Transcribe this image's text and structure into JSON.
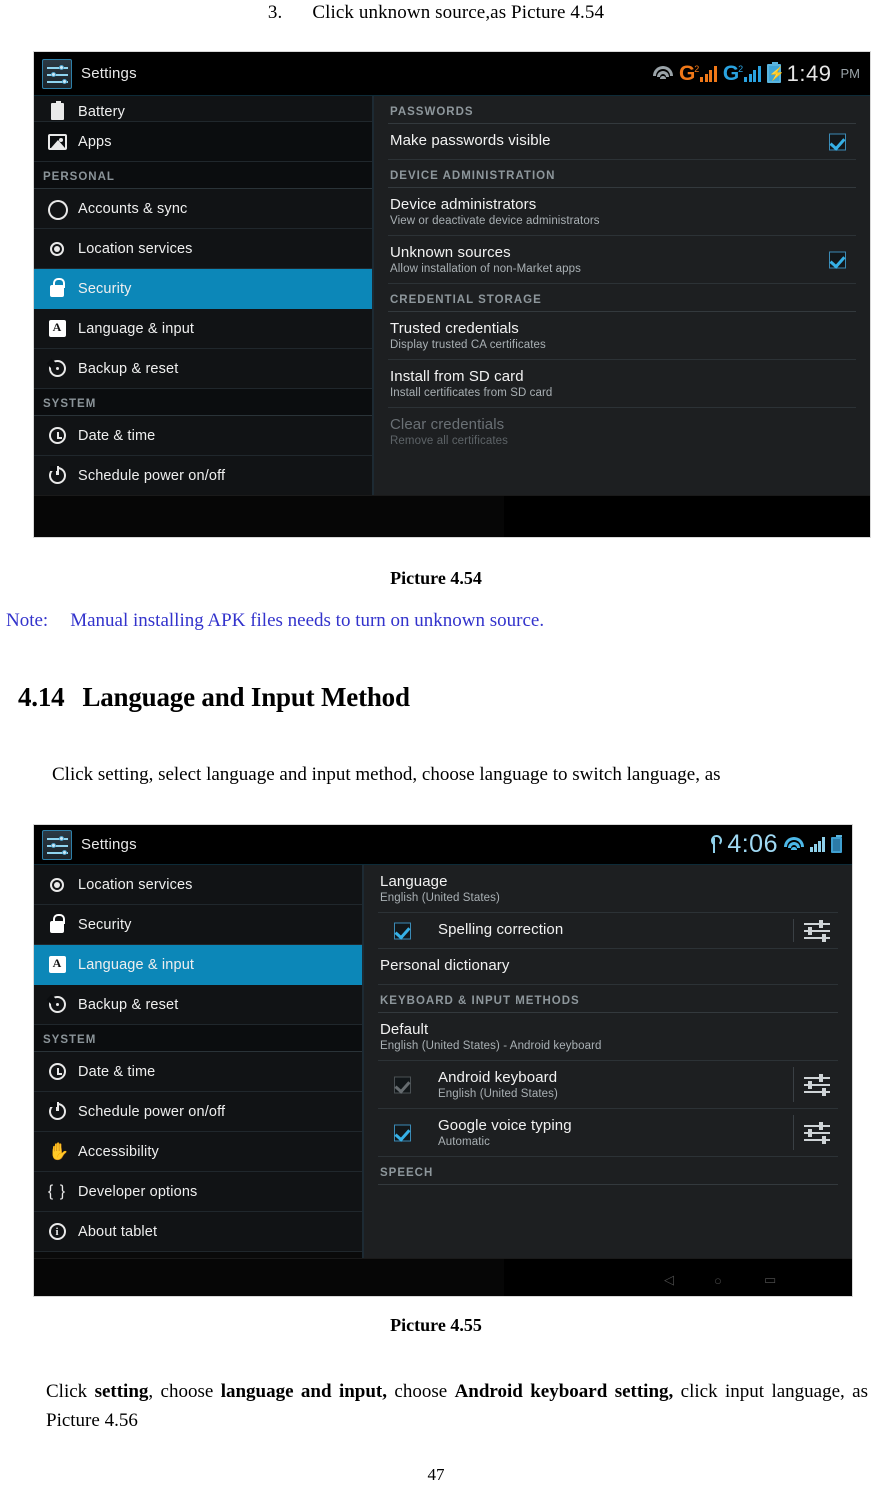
{
  "document": {
    "step_number": "3.",
    "step_text": "Click unknown source,as Picture 4.54",
    "caption_454": "Picture 4.54",
    "note_label": "Note:",
    "note_text": "Manual installing APK files needs to turn on unknown source.",
    "section_number": "4.14",
    "section_title": "Language and Input Method",
    "intro_paragraph": "Click setting, select language and input method, choose language to switch language, as",
    "caption_455": "Picture 4.55",
    "outro": {
      "t1": "Click ",
      "b1": "setting",
      "t2": ", choose ",
      "b2": "language and input,",
      "t3": " choose ",
      "b3": "Android keyboard setting,",
      "t4": " click input language, as Picture 4.56"
    },
    "page_number": "47",
    "note_color": "#3333cc"
  },
  "screenshot_454": {
    "statusbar": {
      "app_title": "Settings",
      "icons": [
        "settings-app-icon",
        "wifi-icon",
        "sim1-g-signal-icon",
        "sim2-g-signal-icon",
        "battery-charging-icon"
      ],
      "sim1": {
        "letter": "G",
        "sup": "2",
        "color": "#f07818"
      },
      "sim2": {
        "letter": "G",
        "sup": "2",
        "color": "#2aa3e0"
      },
      "time": "1:49",
      "ampm": "PM"
    },
    "sidebar": [
      {
        "type": "item",
        "label": "Battery",
        "icon": "battery-icon",
        "selected": false,
        "clipped": true
      },
      {
        "type": "item",
        "label": "Apps",
        "icon": "apps-icon",
        "selected": false
      },
      {
        "type": "header",
        "label": "PERSONAL"
      },
      {
        "type": "item",
        "label": "Accounts & sync",
        "icon": "sync-icon",
        "selected": false
      },
      {
        "type": "item",
        "label": "Location services",
        "icon": "location-icon",
        "selected": false
      },
      {
        "type": "item",
        "label": "Security",
        "icon": "lock-icon",
        "selected": true
      },
      {
        "type": "item",
        "label": "Language & input",
        "icon": "language-a-icon",
        "selected": false
      },
      {
        "type": "item",
        "label": "Backup & reset",
        "icon": "backup-icon",
        "selected": false
      },
      {
        "type": "header",
        "label": "SYSTEM"
      },
      {
        "type": "item",
        "label": "Date & time",
        "icon": "clock-icon",
        "selected": false
      },
      {
        "type": "item",
        "label": "Schedule power on/off",
        "icon": "power-icon",
        "selected": false
      }
    ],
    "content": [
      {
        "type": "header",
        "label": "PASSWORDS"
      },
      {
        "type": "row",
        "title": "Make passwords visible",
        "subtitle": "",
        "checkbox": "checked",
        "checkbox_side": "right"
      },
      {
        "type": "header",
        "label": "DEVICE ADMINISTRATION"
      },
      {
        "type": "row",
        "title": "Device administrators",
        "subtitle": "View or deactivate device administrators",
        "checkbox": "none"
      },
      {
        "type": "row",
        "title": "Unknown sources",
        "subtitle": "Allow installation of non-Market apps",
        "checkbox": "checked",
        "checkbox_side": "right"
      },
      {
        "type": "header",
        "label": "CREDENTIAL STORAGE"
      },
      {
        "type": "row",
        "title": "Trusted credentials",
        "subtitle": "Display trusted CA certificates",
        "checkbox": "none"
      },
      {
        "type": "row",
        "title": "Install from SD card",
        "subtitle": "Install certificates from SD card",
        "checkbox": "none"
      },
      {
        "type": "row",
        "title": "Clear credentials",
        "subtitle": "Remove all certificates",
        "checkbox": "none",
        "disabled": true
      }
    ],
    "selection_color": "#0c87b8"
  },
  "screenshot_455": {
    "statusbar": {
      "app_title": "Settings",
      "icons": [
        "settings-app-icon",
        "usb-icon",
        "wifi-icon",
        "signal-icon",
        "battery-icon"
      ],
      "time": "4:06"
    },
    "sidebar": [
      {
        "type": "item",
        "label": "Location services",
        "icon": "location-icon",
        "selected": false
      },
      {
        "type": "item",
        "label": "Security",
        "icon": "lock-icon",
        "selected": false
      },
      {
        "type": "item",
        "label": "Language & input",
        "icon": "language-a-icon",
        "selected": true
      },
      {
        "type": "item",
        "label": "Backup & reset",
        "icon": "backup-icon",
        "selected": false
      },
      {
        "type": "header",
        "label": "SYSTEM"
      },
      {
        "type": "item",
        "label": "Date & time",
        "icon": "clock-icon",
        "selected": false
      },
      {
        "type": "item",
        "label": "Schedule power on/off",
        "icon": "power-icon",
        "selected": false
      },
      {
        "type": "item",
        "label": "Accessibility",
        "icon": "accessibility-icon",
        "selected": false
      },
      {
        "type": "item",
        "label": "Developer options",
        "icon": "braces-icon",
        "selected": false
      },
      {
        "type": "item",
        "label": "About tablet",
        "icon": "info-icon",
        "selected": false
      }
    ],
    "content": [
      {
        "type": "row",
        "title": "Language",
        "subtitle": "English (United States)",
        "checkbox": "none"
      },
      {
        "type": "row",
        "title": "Spelling correction",
        "subtitle": "",
        "checkbox": "checked",
        "checkbox_side": "left",
        "slider": true,
        "indent": true
      },
      {
        "type": "row",
        "title": "Personal dictionary",
        "subtitle": "",
        "checkbox": "none"
      },
      {
        "type": "header",
        "label": "KEYBOARD & INPUT METHODS"
      },
      {
        "type": "row",
        "title": "Default",
        "subtitle": "English (United States) - Android keyboard",
        "checkbox": "none"
      },
      {
        "type": "row",
        "title": "Android keyboard",
        "subtitle": "English (United States)",
        "checkbox": "unchecked",
        "checkbox_side": "left",
        "slider": true,
        "indent": true
      },
      {
        "type": "row",
        "title": "Google voice typing",
        "subtitle": "Automatic",
        "checkbox": "checked",
        "checkbox_side": "left",
        "slider": true,
        "indent": true
      },
      {
        "type": "header",
        "label": "SPEECH"
      }
    ],
    "selection_color": "#0c87b8"
  }
}
